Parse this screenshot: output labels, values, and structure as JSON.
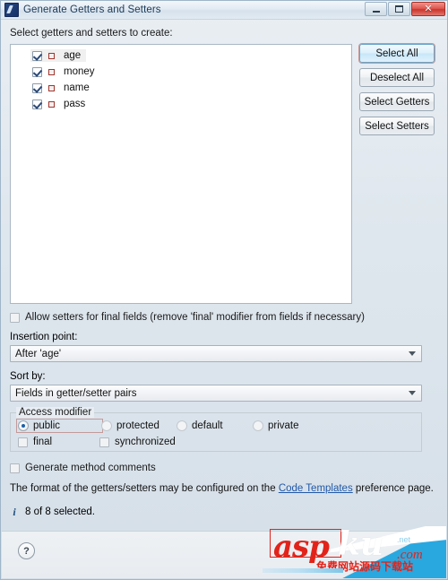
{
  "window": {
    "title": "Generate Getters and Setters",
    "app_icon": "eclipse-java-icon",
    "buttons": {
      "minimize": "minimize-icon",
      "maximize": "maximize-icon",
      "close": "✕"
    }
  },
  "main": {
    "list_label": "Select getters and setters to create:",
    "items": [
      {
        "label": "age",
        "checked": true,
        "icon": "java-field-icon",
        "selected": true
      },
      {
        "label": "money",
        "checked": true,
        "icon": "java-field-icon",
        "selected": false
      },
      {
        "label": "name",
        "checked": true,
        "icon": "java-field-icon",
        "selected": false
      },
      {
        "label": "pass",
        "checked": true,
        "icon": "java-field-icon",
        "selected": false
      }
    ],
    "buttons": [
      {
        "label": "Select All",
        "focused": true
      },
      {
        "label": "Deselect All",
        "focused": false
      },
      {
        "label": "Select Getters",
        "focused": false
      },
      {
        "label": "Select Setters",
        "focused": false
      }
    ],
    "allow_setters_checkbox": {
      "label": "Allow setters for final fields (remove 'final' modifier from fields if necessary)",
      "checked": false
    },
    "insertion_point": {
      "label": "Insertion point:",
      "value": "After 'age'"
    },
    "sort_by": {
      "label": "Sort by:",
      "value": "Fields in getter/setter pairs"
    },
    "access_modifier": {
      "title": "Access modifier",
      "radios": [
        {
          "label": "public",
          "selected": true,
          "focused": true
        },
        {
          "label": "protected",
          "selected": false,
          "focused": false
        },
        {
          "label": "default",
          "selected": false,
          "focused": false
        },
        {
          "label": "private",
          "selected": false,
          "focused": false
        }
      ],
      "checkboxes": [
        {
          "label": "final",
          "checked": false
        },
        {
          "label": "synchronized",
          "checked": false
        }
      ]
    },
    "generate_comments_checkbox": {
      "label": "Generate method comments",
      "checked": false
    },
    "note": {
      "prefix": "The format of the getters/setters may be configured on the ",
      "link": "Code Templates",
      "suffix": " preference page."
    },
    "status": {
      "icon": "info-icon",
      "text": "8 of 8 selected."
    }
  },
  "footer": {
    "help_label": "?"
  },
  "watermark": {
    "asp": "asp",
    "ku": "ku",
    "com": ".com",
    "net": ".net",
    "chinese": "免费网站源码下载站"
  },
  "colors": {
    "accent_blue": "#1a5fa8",
    "link_blue": "#2058a8",
    "close_red": "#c9362d",
    "field_icon_red": "#a0362e",
    "watermark_red": "#e2231a",
    "watermark_blue": "#29a8e0"
  }
}
